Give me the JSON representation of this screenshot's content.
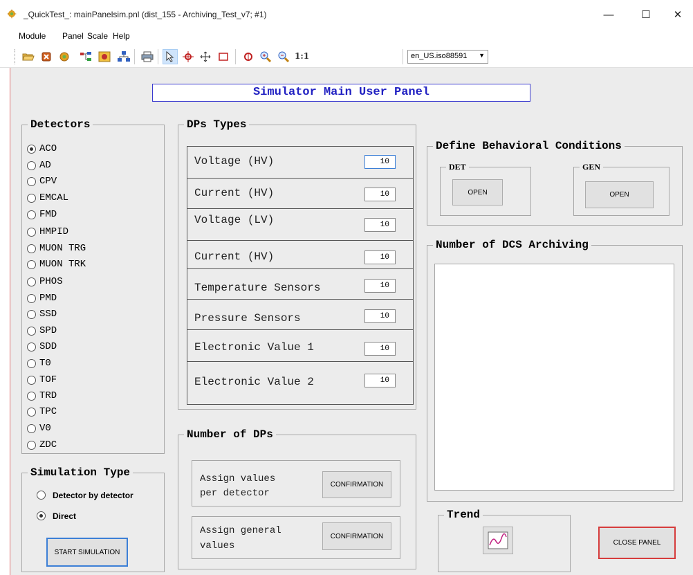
{
  "window": {
    "title": "_QuickTest_: mainPanelsim.pnl (dist_155 - Archiving_Test_v7; #1)",
    "minimize": "—",
    "maximize": "☐",
    "close": "✕"
  },
  "menu": [
    "Module",
    "Panel",
    "Scale",
    "Help"
  ],
  "toolbar": {
    "icons": [
      "open-folder-icon",
      "close-panel-icon",
      "settings-gear-icon",
      "tree-view-icon",
      "image-icon",
      "hierarchy-icon",
      "print-icon",
      "select-pointer-icon",
      "move-tool-icon",
      "pan-cross-icon",
      "rectangle-icon",
      "zoom-reset-icon",
      "zoom-in-icon",
      "zoom-out-icon"
    ],
    "scale_label": "1:1",
    "locale": "en_US.iso88591",
    "locale_arrow": "▼"
  },
  "main_title": "Simulator Main User Panel",
  "detectors": {
    "legend": "Detectors",
    "items": [
      "ACO",
      "AD",
      "CPV",
      "EMCAL",
      "FMD",
      "HMPID",
      "MUON TRG",
      "MUON TRK",
      "PHOS",
      "PMD",
      "SSD",
      "SPD",
      "SDD",
      "T0",
      "TOF",
      "TRD",
      "TPC",
      "V0",
      "ZDC"
    ],
    "selected": "ACO"
  },
  "dp_types": {
    "legend": "DPs Types",
    "rows": [
      {
        "label": "Voltage (HV)",
        "value": "10"
      },
      {
        "label": "Current (HV)",
        "value": "10"
      },
      {
        "label": "Voltage (LV)",
        "value": "10"
      },
      {
        "label": "Current (HV)",
        "value": "10"
      },
      {
        "label": "Temperature Sensors",
        "value": "10"
      },
      {
        "label": "Pressure Sensors",
        "value": "10"
      },
      {
        "label": "Electronic Value 1",
        "value": "10"
      },
      {
        "label": "Electronic Value 2",
        "value": "10"
      }
    ]
  },
  "behavioral": {
    "legend": "Define Behavioral Conditions",
    "det_label": "DET",
    "gen_label": "GEN",
    "det_button": "OPEN",
    "gen_button": "OPEN"
  },
  "archiving": {
    "legend": "Number of DCS Archiving"
  },
  "simulation_type": {
    "legend": "Simulation Type",
    "options": [
      "Detector by detector",
      "Direct"
    ],
    "selected": "Direct",
    "start_button": "START SIMULATION"
  },
  "number_of_dps": {
    "legend": "Number of DPs",
    "per_detector_label_1": "Assign values",
    "per_detector_label_2": "per detector",
    "general_label_1": "Assign general",
    "general_label_2": "values",
    "confirm_button_1": "CONFIRMATION",
    "confirm_button_2": "CONFIRMATION"
  },
  "trend": {
    "legend": "Trend",
    "icon": "trend-chart-icon"
  },
  "close_panel_button": "CLOSE PANEL"
}
